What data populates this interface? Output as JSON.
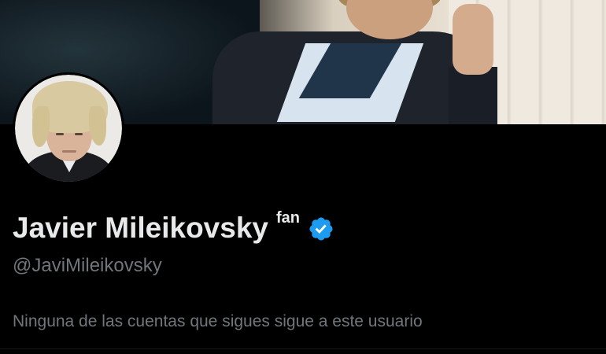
{
  "profile": {
    "display_name": "Javier Mileikovsky",
    "name_suffix": "fan",
    "handle": "@JaviMileikovsky",
    "follow_note": "Ninguna de las cuentas que sigues sigue a este usuario"
  },
  "icons": {
    "verified": "verified-badge-icon"
  },
  "colors": {
    "background": "#000000",
    "primary_text": "#e7e9ea",
    "secondary_text": "#71767b",
    "verified_blue": "#1d9bf0"
  }
}
